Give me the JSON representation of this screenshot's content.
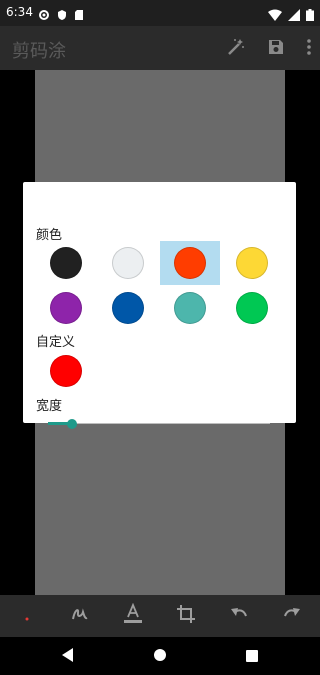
{
  "status_bar": {
    "time": "6:34"
  },
  "app_bar": {
    "title": "剪码涂"
  },
  "dialog": {
    "color_label": "颜色",
    "custom_label": "自定义",
    "width_label": "宽度",
    "swatches": [
      "#212121",
      "#eceff1",
      "#ff3d00",
      "#fdd835",
      "#8e24aa",
      "#0057a8",
      "#4db6ac",
      "#00c853"
    ],
    "selected_index": 2,
    "custom_color": "#ff0000",
    "width_level_fraction": 0.11
  },
  "toolbar": {
    "icons": [
      "dot-brush-icon",
      "pen-icon",
      "text-icon",
      "crop-icon",
      "undo-icon",
      "redo-icon"
    ]
  }
}
